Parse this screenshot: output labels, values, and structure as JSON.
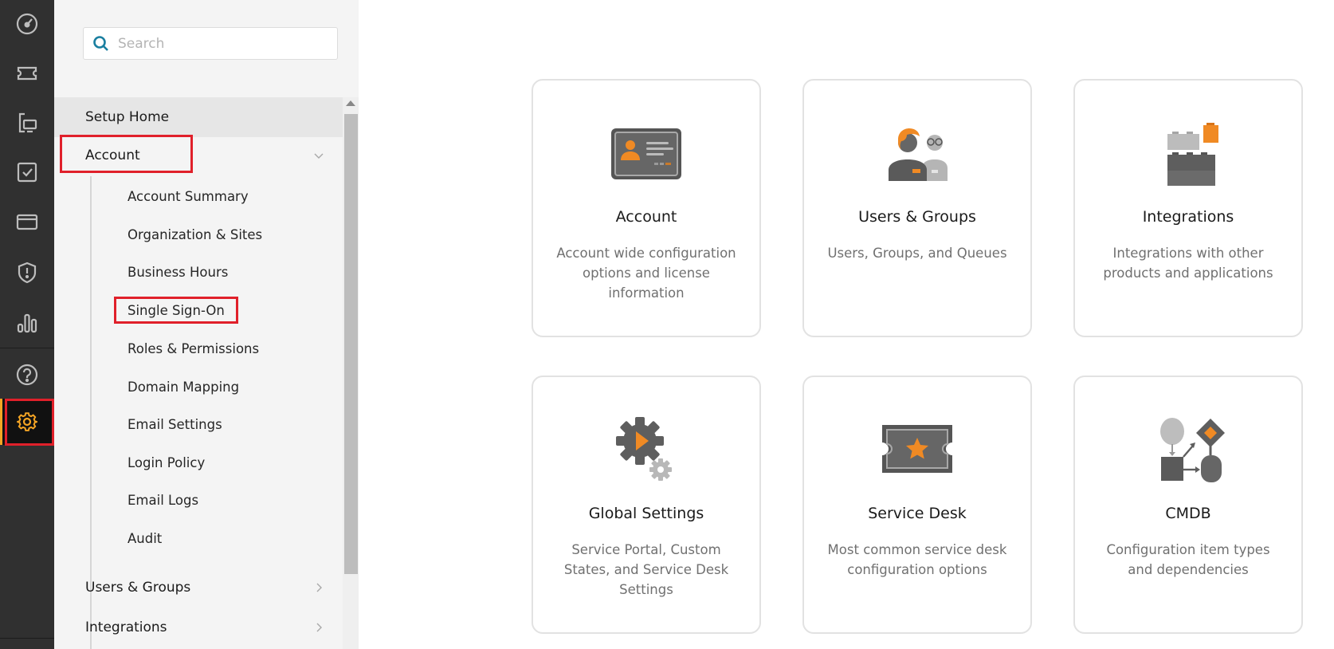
{
  "rail": {
    "items": [
      {
        "icon": "dashboard-gauge-icon"
      },
      {
        "icon": "ticket-icon"
      },
      {
        "icon": "devices-icon"
      },
      {
        "icon": "task-checkbox-icon"
      },
      {
        "icon": "card-icon"
      },
      {
        "icon": "shield-alert-icon"
      },
      {
        "icon": "reports-bar-chart-icon"
      },
      {
        "icon": "help-question-icon"
      },
      {
        "icon": "settings-gear-icon",
        "active": true
      }
    ],
    "accent_color": "#f5a524"
  },
  "sidebar": {
    "search": {
      "placeholder": "Search",
      "value": ""
    },
    "top_items": [
      {
        "label": "Setup Home",
        "current": true
      },
      {
        "label": "Account",
        "expanded": true
      },
      {
        "label": "Users & Groups",
        "expanded": false
      },
      {
        "label": "Integrations",
        "expanded": false
      }
    ],
    "account_sub_items": [
      "Account Summary",
      "Organization & Sites",
      "Business Hours",
      "Single Sign-On",
      "Roles & Permissions",
      "Domain Mapping",
      "Email Settings",
      "Login Policy",
      "Email Logs",
      "Audit"
    ]
  },
  "annotations": {
    "highlight_color": "#e0202a",
    "highlighted": [
      "Account",
      "Single Sign-On",
      "settings-gear-icon"
    ]
  },
  "cards": [
    {
      "title": "Account",
      "description": "Account wide configuration options and license information",
      "icon": "id-card-icon"
    },
    {
      "title": "Users & Groups",
      "description": "Users, Groups, and Queues",
      "icon": "users-icon"
    },
    {
      "title": "Integrations",
      "description": "Integrations with other products and applications",
      "icon": "building-blocks-icon"
    },
    {
      "title": "Global Settings",
      "description": "Service Portal, Custom States, and Service Desk Settings",
      "icon": "gear-play-icon"
    },
    {
      "title": "Service Desk",
      "description": "Most common service desk configuration options",
      "icon": "ticket-star-icon"
    },
    {
      "title": "CMDB",
      "description": "Configuration item types and dependencies",
      "icon": "flow-diagram-icon"
    }
  ],
  "colors": {
    "brand_orange": "#f08a24",
    "icon_gray": "#5f5f5f",
    "search_icon": "#1a7fa0"
  }
}
